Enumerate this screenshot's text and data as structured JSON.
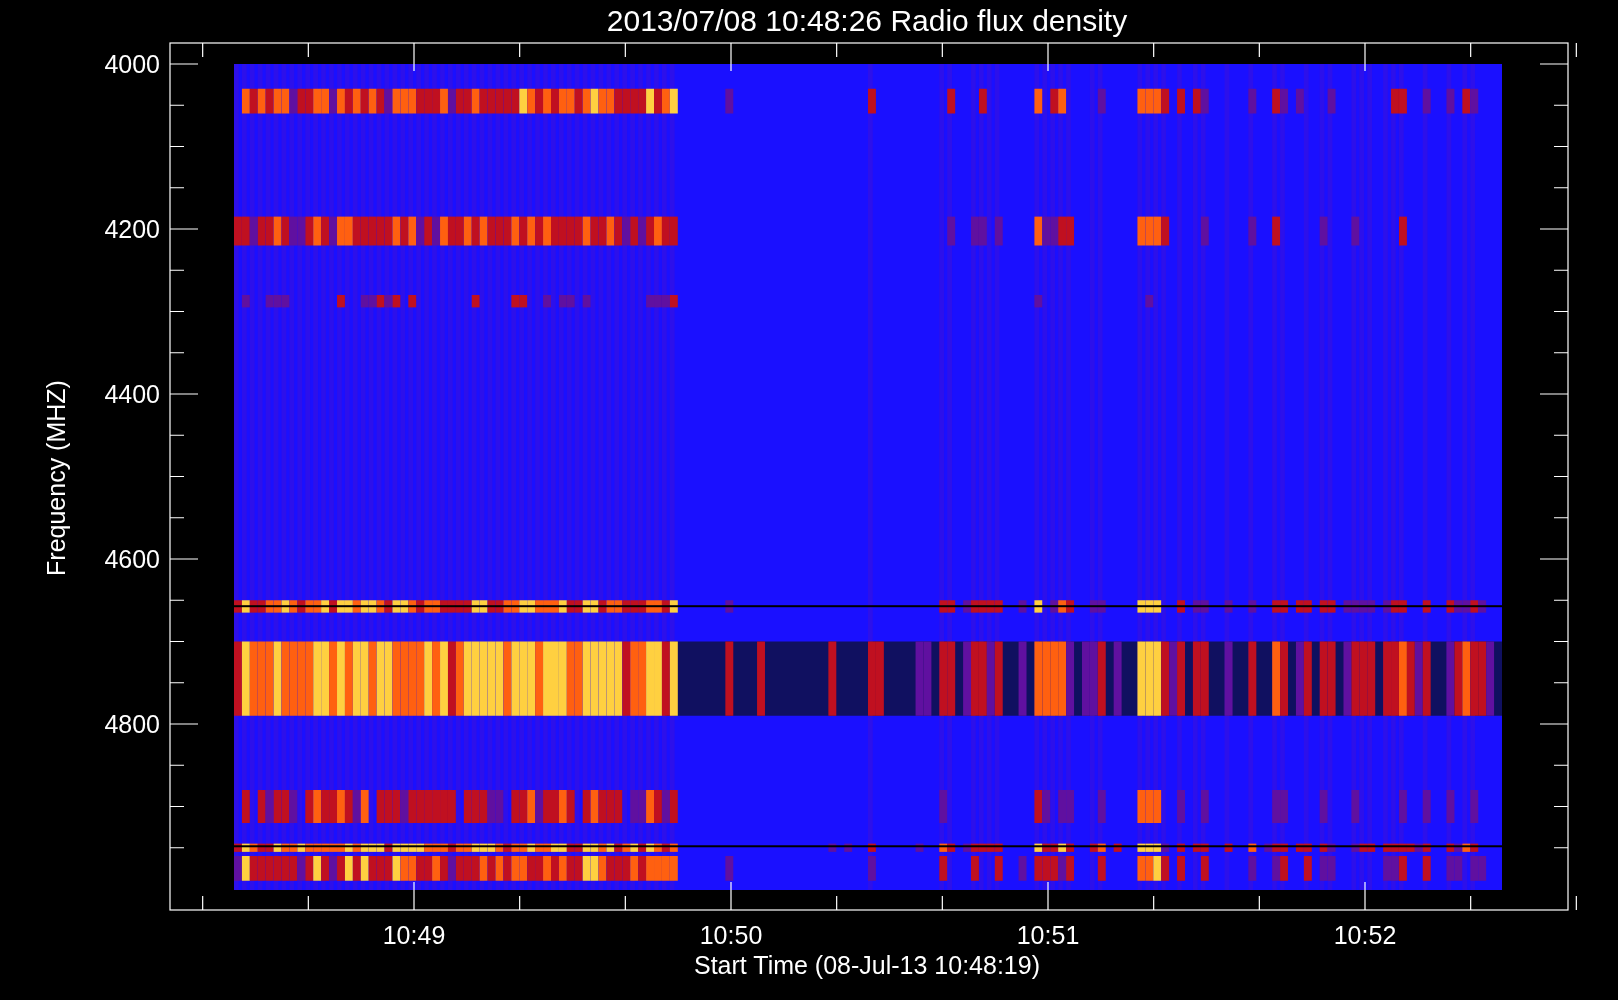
{
  "chart": {
    "title": "2013/07/08 10:48:26 Radio flux density",
    "y_axis": {
      "label": "Frequency (MHZ)",
      "ticks": [
        "4000",
        "4200",
        "4400",
        "4600",
        "4800"
      ]
    },
    "x_axis": {
      "label": "Start Time (08-Jul-13 10:48:19)",
      "ticks": [
        "10:49",
        "10:50",
        "10:51",
        "10:52"
      ]
    }
  }
}
